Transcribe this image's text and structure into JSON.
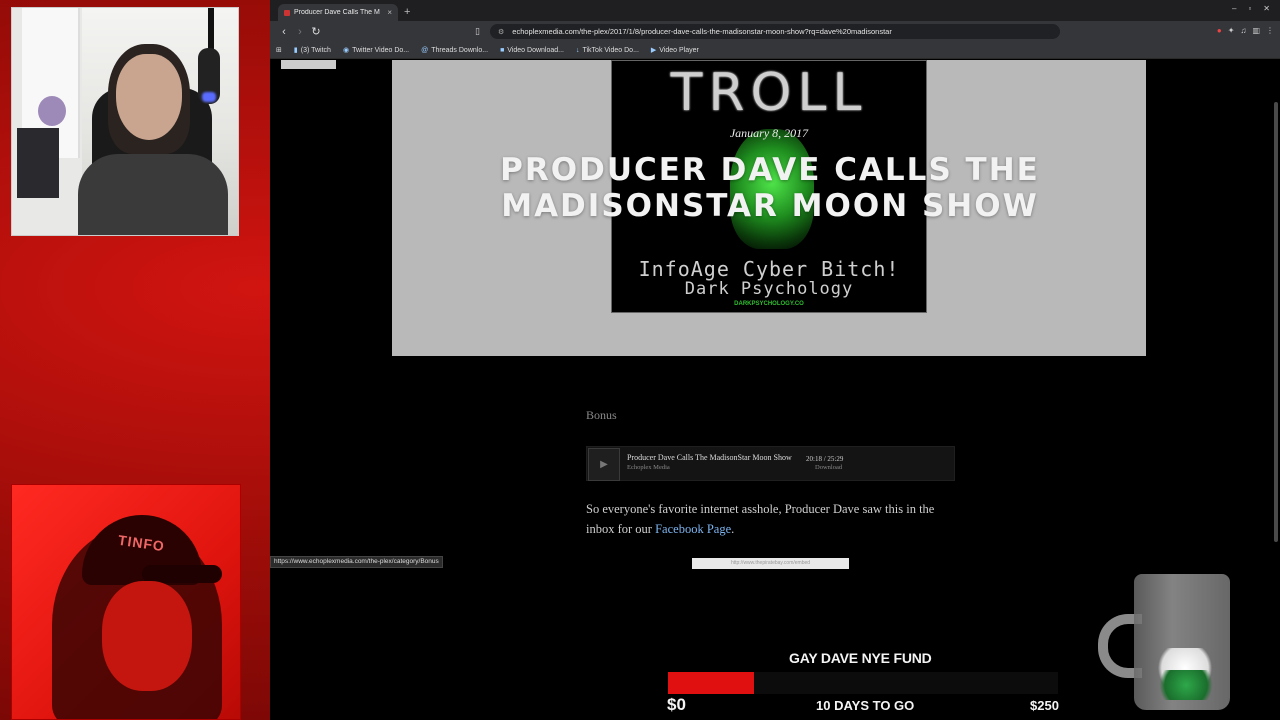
{
  "browser": {
    "tab": {
      "title": "Producer Dave Calls The M",
      "close": "×"
    },
    "new_tab": "+",
    "window_controls": [
      "–",
      "▫",
      "✕"
    ],
    "nav": {
      "back": "‹",
      "forward": "›",
      "reload": "↻"
    },
    "url": "echoplexmedia.com/the-plex/2017/1/8/producer-dave-calls-the-madisonstar-moon-show?rq=dave%20madisonstar",
    "bookmarks": [
      {
        "label": "(3) Twitch",
        "icon": "twitch-icon"
      },
      {
        "label": "Twitter Video Do...",
        "icon": "download-icon"
      },
      {
        "label": "Threads Downlo...",
        "icon": "threads-icon"
      },
      {
        "label": "Video Download...",
        "icon": "video-icon"
      },
      {
        "label": "TikTok Video Do...",
        "icon": "tiktok-icon"
      },
      {
        "label": "Video Player",
        "icon": "player-icon"
      }
    ],
    "status_url": "https://www.echoplexmedia.com/the-plex/category/Bonus"
  },
  "post": {
    "image": {
      "top_text": "TROLL",
      "line1": "InfoAge Cyber Bitch!",
      "line2": "Dark Psychology",
      "site": "DARKPSYCHOLOGY.CO"
    },
    "date": "January 8, 2017",
    "title": "Producer Dave Calls the MadisonStar Moon Show",
    "category": "Bonus",
    "player": {
      "track": "Producer Dave Calls The MadisonStar Moon Show",
      "artist": "Echoplex Media",
      "time": "20:18 / 25:29",
      "download": "Download"
    },
    "body_text": "So everyone's favorite internet asshole, Producer Dave saw this in the inbox for our ",
    "body_link": "Facebook Page",
    "body_end": ".",
    "embed_text": "http://www.thepiratebay.com/embed"
  },
  "fundraiser": {
    "title": "GAY DAVE NYE FUND",
    "amount": "$0",
    "days": "10 DAYS TO GO",
    "goal": "$250",
    "progress": 0.22,
    "fill_color": "#e01010"
  }
}
